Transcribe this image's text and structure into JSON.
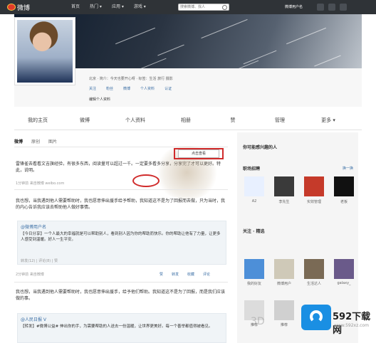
{
  "app": {
    "logo_text": "微博"
  },
  "nav": [
    "首页",
    "热门 ▾",
    "应用 ▾",
    "游戏 ▾"
  ],
  "search": {
    "placeholder": "搜索微博、找人"
  },
  "top_user": "微博用户名",
  "profile": {
    "info": "北京 · 简介：今天也要开心呀 · 标签：生活 旅行 摄影",
    "stats": [
      "关注",
      "粉丝",
      "微博",
      "个人资料",
      "认证"
    ],
    "edit_label": "编辑个人资料"
  },
  "tabs": [
    "我的主页",
    "微博",
    "个人资料",
    "相册",
    "赞",
    "管理",
    "更多 ▾"
  ],
  "subtabs": [
    "微博",
    "原创",
    "图片"
  ],
  "feed": {
    "post1": "雷锋雀去看看文吉旗经验，有很多东西，阅读量可以超过一千。一定要多看多分享，分享完了才可以更好。特此，说明。",
    "meta1": "1分钟前 来自微博 weibo.com",
    "hover_label": "点击查看",
    "post2": "我也想，当我遇到他人需要帮助时，我也愿意伸出援手给予帮助，我知道这不是为了回报而去做，只为当时，我的内心告诉我应该去帮助他人做好事情。",
    "repost_title": "@微博用户名",
    "repost_body": "【今日分享】一个人最大的幸福就是可以帮助别人，看到别人因为你的帮助而快乐。你的帮助让他有了力量，让更多人感受到温暖。好人一生平安。",
    "repost_meta": "转发(12) | 评论(8) | 赞",
    "meta2": "2分钟前 来自微博",
    "actions": [
      "赞",
      "转发",
      "收藏",
      "评论"
    ],
    "post3": "我也想，当我遇到他人需要帮助时，我也愿意伸出援手，给予他们帮助。我知道这不是为了回报，而是我们应该做的事。",
    "repost2_title": "@人民日报 V",
    "repost2_body": "【转发】#微博公益# 伸出你的手，为需要帮助的人送去一份温暖，让世界更美好。每一个善举都值得被看见。"
  },
  "sidebar": {
    "title1": "你可能感兴趣的人",
    "title2": "职场招聘",
    "more": "换一换",
    "people1": [
      "A2",
      "李先生",
      "实效管理",
      "老板"
    ],
    "title3": "关注 · 精选",
    "people2": [
      "我的好友",
      "微博用户",
      "生活达人",
      "galaxy_"
    ],
    "people3": [
      "推荐",
      "推荐"
    ]
  },
  "watermark": {
    "brand": "592下载网",
    "url": "www.592xz.com",
    "overlay": "3D"
  },
  "colors": {
    "topbar": "#2f3337",
    "link": "#3a6ea5",
    "highlight": "#d02b2b",
    "watermark": "#1a8fe3"
  }
}
